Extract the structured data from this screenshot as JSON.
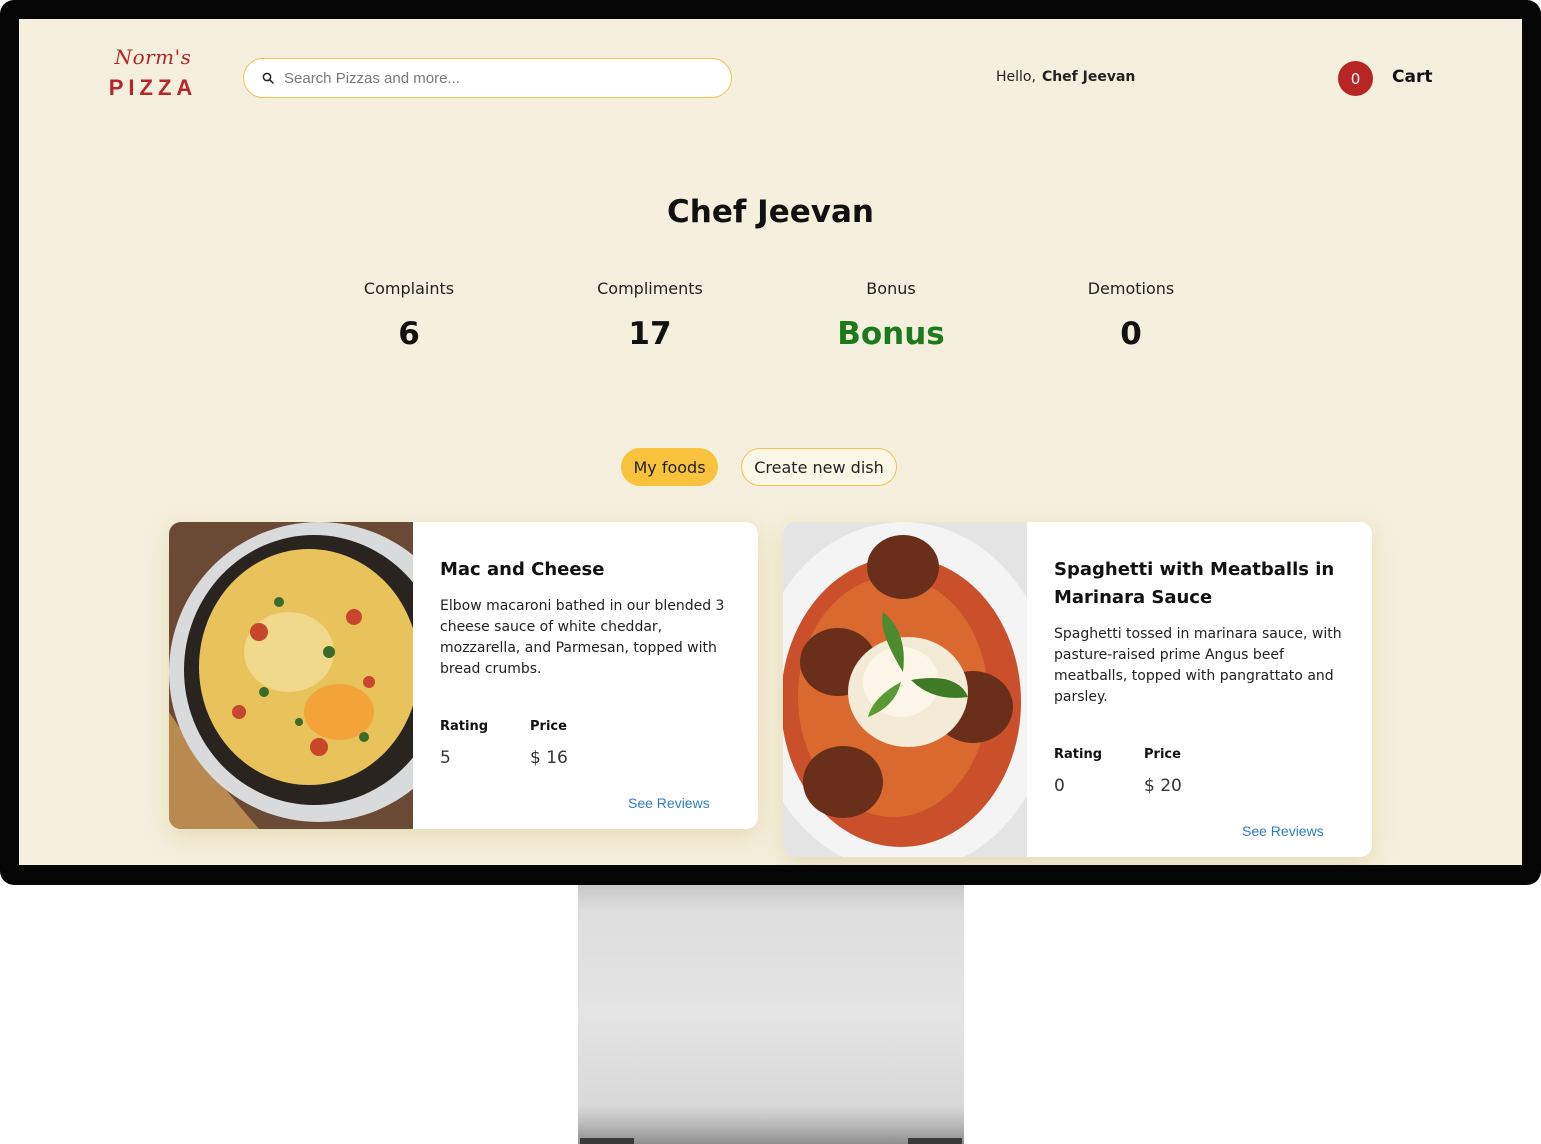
{
  "header": {
    "logo_script": "Norm's",
    "logo_main": "PIZZA",
    "search_placeholder": "Search Pizzas and more...",
    "greeting": "Hello,",
    "user_name": "Chef Jeevan",
    "cart_count": "0",
    "cart_label": "Cart"
  },
  "profile": {
    "title": "Chef Jeevan",
    "stats": [
      {
        "label": "Complaints",
        "value": "6"
      },
      {
        "label": "Compliments",
        "value": "17"
      },
      {
        "label": "Bonus",
        "value": "Bonus"
      },
      {
        "label": "Demotions",
        "value": "0"
      }
    ]
  },
  "tabs": [
    {
      "label": "My foods",
      "active": true
    },
    {
      "label": "Create new dish",
      "active": false
    }
  ],
  "foods": [
    {
      "name": "Mac and Cheese",
      "description": "Elbow macaroni bathed in our blended 3 cheese sauce of white cheddar, mozzarella, and Parmesan, topped with bread crumbs.",
      "rating_label": "Rating",
      "rating": "5",
      "price_label": "Price",
      "price": "$ 16",
      "reviews_link": "See Reviews"
    },
    {
      "name": "Spaghetti with Meatballs in Marinara Sauce",
      "description": "Spaghetti tossed in marinara sauce, with pasture-raised prime Angus beef meatballs, topped with pangrattato and parsley.",
      "rating_label": "Rating",
      "rating": "0",
      "price_label": "Price",
      "price": "$ 20",
      "reviews_link": "See Reviews"
    }
  ],
  "colors": {
    "background": "#f5f0dd",
    "brand_red": "#b4262b",
    "accent_yellow": "#f9c23c",
    "bonus_green": "#1c7a1c",
    "link_blue": "#2f7dc0"
  }
}
